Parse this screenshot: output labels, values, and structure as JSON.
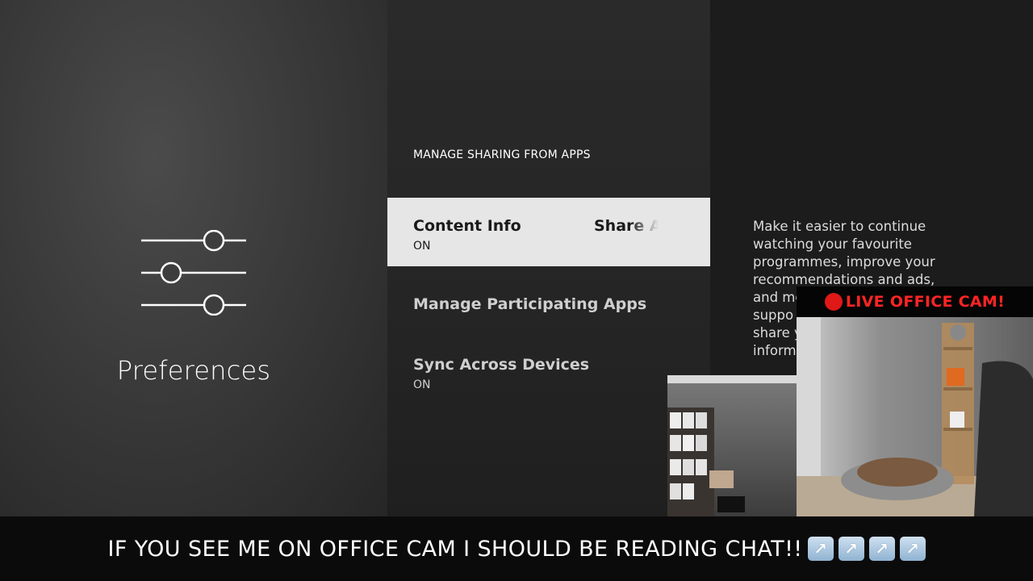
{
  "preferences": {
    "title": "Preferences",
    "icon": "sliders-icon"
  },
  "sharing": {
    "section_title": "MANAGE SHARING FROM APPS",
    "items": [
      {
        "label": "Content Info",
        "value": "ON",
        "focused": true
      },
      {
        "label": "Share A",
        "focused": true
      },
      {
        "label": "Manage Participating Apps"
      },
      {
        "label": "Sync Across Devices",
        "value": "ON"
      }
    ]
  },
  "description": "Make it easier to continue watching your favourite programmes, improve your recommendations and ads, and mo supp share y inform",
  "description_lines": [
    "Make it easier to continue",
    "watching your favourite",
    "programmes, improve your",
    "recommendations and ads,",
    "and mo",
    "suppo",
    "share y",
    "inform"
  ],
  "overlay": {
    "live_label": "LIVE OFFICE CAM!",
    "live_icon": "red-circle-icon",
    "bottom_text": "IF YOU SEE ME ON OFFICE CAM I SHOULD BE READING CHAT!!",
    "arrow_icons": [
      "up-right-arrow-icon",
      "up-right-arrow-icon",
      "up-right-arrow-icon",
      "up-right-arrow-icon"
    ],
    "arrow_glyph": "↗",
    "colors": {
      "live_red": "#ff2424",
      "focus_bg": "#e6e6e6"
    }
  }
}
